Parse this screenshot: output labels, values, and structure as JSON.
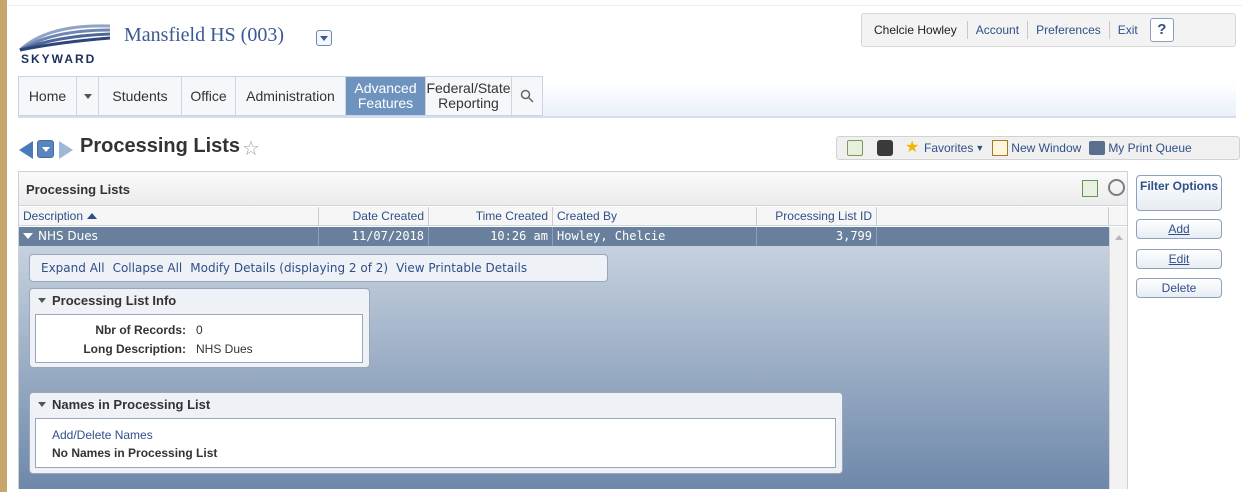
{
  "header": {
    "brand": "SKYWARD",
    "school": "Mansfield HS (003)",
    "user_name": "Chelcie Howley",
    "links": [
      "Account",
      "Preferences",
      "Exit"
    ],
    "help": "?"
  },
  "nav": {
    "home": "Home",
    "students": "Students",
    "office": "Office",
    "administration": "Administration",
    "advanced_features": "Advanced Features",
    "federal_state": "Federal/State Reporting"
  },
  "page": {
    "title": "Processing Lists",
    "toolbar": {
      "favorites": "Favorites",
      "new_window": "New Window",
      "print_queue": "My Print Queue"
    }
  },
  "panel": {
    "title": "Processing Lists",
    "columns": [
      "Description",
      "Date Created",
      "Time Created",
      "Created By",
      "Processing List ID"
    ],
    "rows": [
      {
        "description": "NHS Dues",
        "date_created": "11/07/2018",
        "time_created": "10:26 am",
        "created_by": "Howley, Chelcie",
        "processing_list_id": "3,799"
      }
    ],
    "detail_links": [
      "Expand All",
      "Collapse All",
      "Modify Details (displaying 2 of 2)",
      "View Printable Details"
    ],
    "info_group": {
      "title": "Processing List Info",
      "fields": [
        {
          "label": "Nbr of Records:",
          "value": "0"
        },
        {
          "label": "Long Description:",
          "value": "NHS Dues"
        }
      ]
    },
    "names_group": {
      "title": "Names in Processing List",
      "link": "Add/Delete Names",
      "empty_text": "No Names in Processing List"
    }
  },
  "actions": {
    "filter": "Filter Options",
    "add": "Add",
    "edit": "Edit",
    "delete": "Delete"
  },
  "colors": {
    "selected_row": "#69809d",
    "active_tab": "#6f93bf",
    "link": "#2f4f89"
  }
}
